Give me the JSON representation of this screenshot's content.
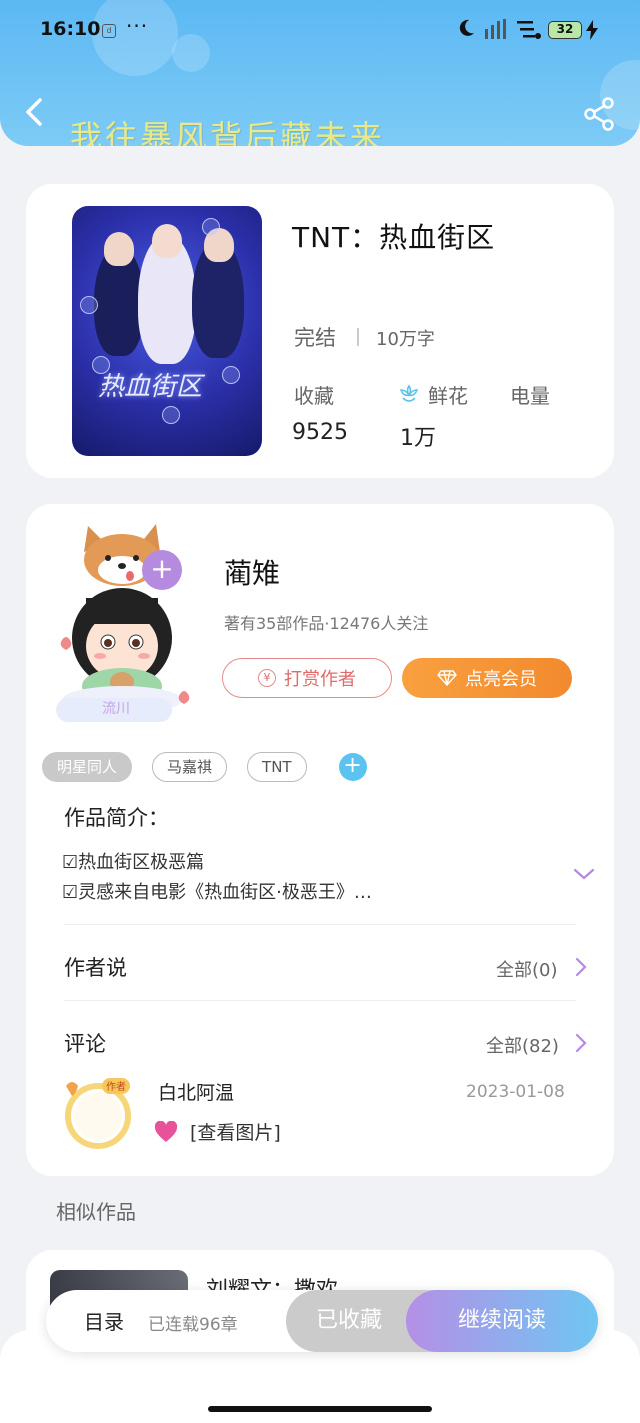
{
  "status_bar": {
    "time": "16:10",
    "dots": "···",
    "battery": "32"
  },
  "header": {
    "banner_text": "我往暴风背后藏未来"
  },
  "book": {
    "title": "TNT：热血街区",
    "cover_title": "热血街区",
    "status": "完结",
    "word_count": "10万字",
    "stats": [
      {
        "label": "收藏",
        "value": "9525"
      },
      {
        "label": "鲜花",
        "value": "1万"
      },
      {
        "label": "电量",
        "value": ""
      }
    ]
  },
  "author": {
    "name": "蔺雉",
    "meta": "著有35部作品·12476人关注",
    "badge": "流川",
    "reward_label": "打赏作者",
    "vip_label": "点亮会员"
  },
  "tags": [
    "明星同人",
    "马嘉祺",
    "TNT"
  ],
  "intro": {
    "title": "作品简介：",
    "lines": [
      "☑热血街区极恶篇",
      "☑灵感来自电影《热血街区·极恶王》…"
    ]
  },
  "author_says": {
    "title": "作者说",
    "link": "全部(0)"
  },
  "comments": {
    "title": "评论",
    "link": "全部(82)",
    "items": [
      {
        "user": "白北阿温",
        "date": "2023-01-08",
        "text": "[查看图片]",
        "avatar_badge": "作者"
      }
    ]
  },
  "similar": {
    "title": "相似作品",
    "first_title": "刘耀文：撒欢"
  },
  "bottom_bar": {
    "toc_label": "目录",
    "toc_meta": "已连载96章",
    "collected_label": "已收藏",
    "read_label": "继续阅读"
  },
  "colors": {
    "header": "#5cb8f3",
    "accent_purple": "#b58be0",
    "accent_orange": "#f28a2e",
    "accent_blue": "#5cc3f1"
  }
}
